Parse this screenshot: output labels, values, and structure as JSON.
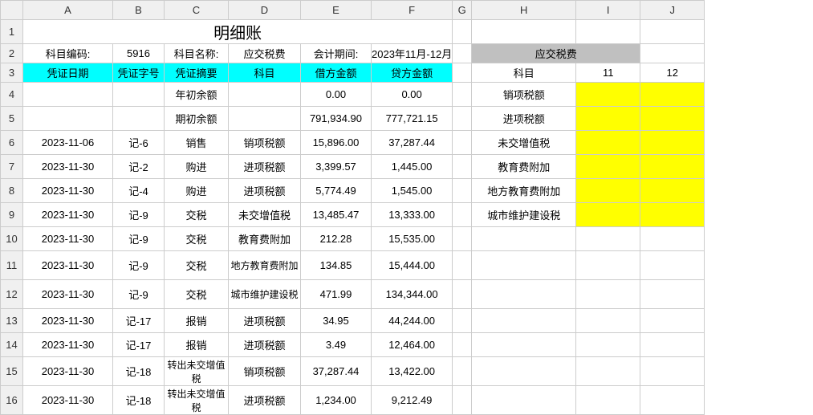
{
  "columns": [
    "A",
    "B",
    "C",
    "D",
    "E",
    "F",
    "G",
    "H",
    "I",
    "J"
  ],
  "title": "明细账",
  "info": {
    "code_label": "科目编码:",
    "code_value": "5916",
    "name_label": "科目名称:",
    "name_value": "应交税费",
    "period_label": "会计期间:",
    "period_value": "2023年11月-12月"
  },
  "main_headers": [
    "凭证日期",
    "凭证字号",
    "凭证摘要",
    "科目",
    "借方金额",
    "贷方金额"
  ],
  "rows": [
    {
      "date": "",
      "voucher": "",
      "summary": "年初余额",
      "subject": "",
      "debit": "0.00",
      "credit": "0.00"
    },
    {
      "date": "",
      "voucher": "",
      "summary": "期初余额",
      "subject": "",
      "debit": "791,934.90",
      "credit": "777,721.15"
    },
    {
      "date": "2023-11-06",
      "voucher": "记-6",
      "summary": "销售",
      "subject": "销项税额",
      "debit": "15,896.00",
      "credit": "37,287.44"
    },
    {
      "date": "2023-11-30",
      "voucher": "记-2",
      "summary": "购进",
      "subject": "进项税额",
      "debit": "3,399.57",
      "credit": "1,445.00"
    },
    {
      "date": "2023-11-30",
      "voucher": "记-4",
      "summary": "购进",
      "subject": "进项税额",
      "debit": "5,774.49",
      "credit": "1,545.00"
    },
    {
      "date": "2023-11-30",
      "voucher": "记-9",
      "summary": "交税",
      "subject": "未交增值税",
      "debit": "13,485.47",
      "credit": "13,333.00"
    },
    {
      "date": "2023-11-30",
      "voucher": "记-9",
      "summary": "交税",
      "subject": "教育费附加",
      "debit": "212.28",
      "credit": "15,535.00"
    },
    {
      "date": "2023-11-30",
      "voucher": "记-9",
      "summary": "交税",
      "subject": "地方教育费附加",
      "debit": "134.85",
      "credit": "15,444.00"
    },
    {
      "date": "2023-11-30",
      "voucher": "记-9",
      "summary": "交税",
      "subject": "城市维护建设税",
      "debit": "471.99",
      "credit": "134,344.00"
    },
    {
      "date": "2023-11-30",
      "voucher": "记-17",
      "summary": "报销",
      "subject": "进项税额",
      "debit": "34.95",
      "credit": "44,244.00"
    },
    {
      "date": "2023-11-30",
      "voucher": "记-17",
      "summary": "报销",
      "subject": "进项税额",
      "debit": "3.49",
      "credit": "12,464.00"
    },
    {
      "date": "2023-11-30",
      "voucher": "记-18",
      "summary": "转出未交增值税",
      "subject": "销项税额",
      "debit": "37,287.44",
      "credit": "13,422.00"
    },
    {
      "date": "2023-11-30",
      "voucher": "记-18",
      "summary": "转出未交增值税",
      "subject": "进项税额",
      "debit": "1,234.00",
      "credit": "9,212.49"
    }
  ],
  "side": {
    "title": "应交税费",
    "header_subject": "科目",
    "col1": "11",
    "col2": "12",
    "items": [
      "销项税额",
      "进项税额",
      "未交增值税",
      "教育费附加",
      "地方教育费附加",
      "城市维护建设税"
    ]
  }
}
